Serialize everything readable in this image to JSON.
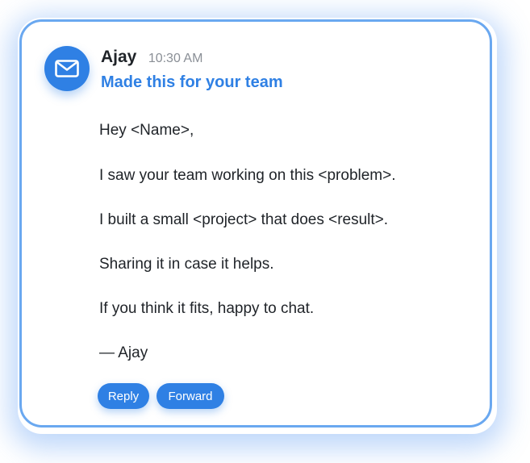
{
  "message": {
    "avatar_icon": "mail-icon",
    "sender": "Ajay",
    "time": "10:30 AM",
    "subject": "Made this for your team",
    "body": [
      "Hey <Name>,",
      "I saw your team working on this <problem>.",
      "I built a small <project> that does <result>.",
      "Sharing it in case it helps.",
      "If you think it fits, happy to chat.",
      "— Ajay"
    ]
  },
  "actions": {
    "reply_label": "Reply",
    "forward_label": "Forward"
  },
  "colors": {
    "accent": "#2f80e4",
    "card_border": "#6aa8f0",
    "text": "#1f2328",
    "muted": "#8a8f96"
  }
}
